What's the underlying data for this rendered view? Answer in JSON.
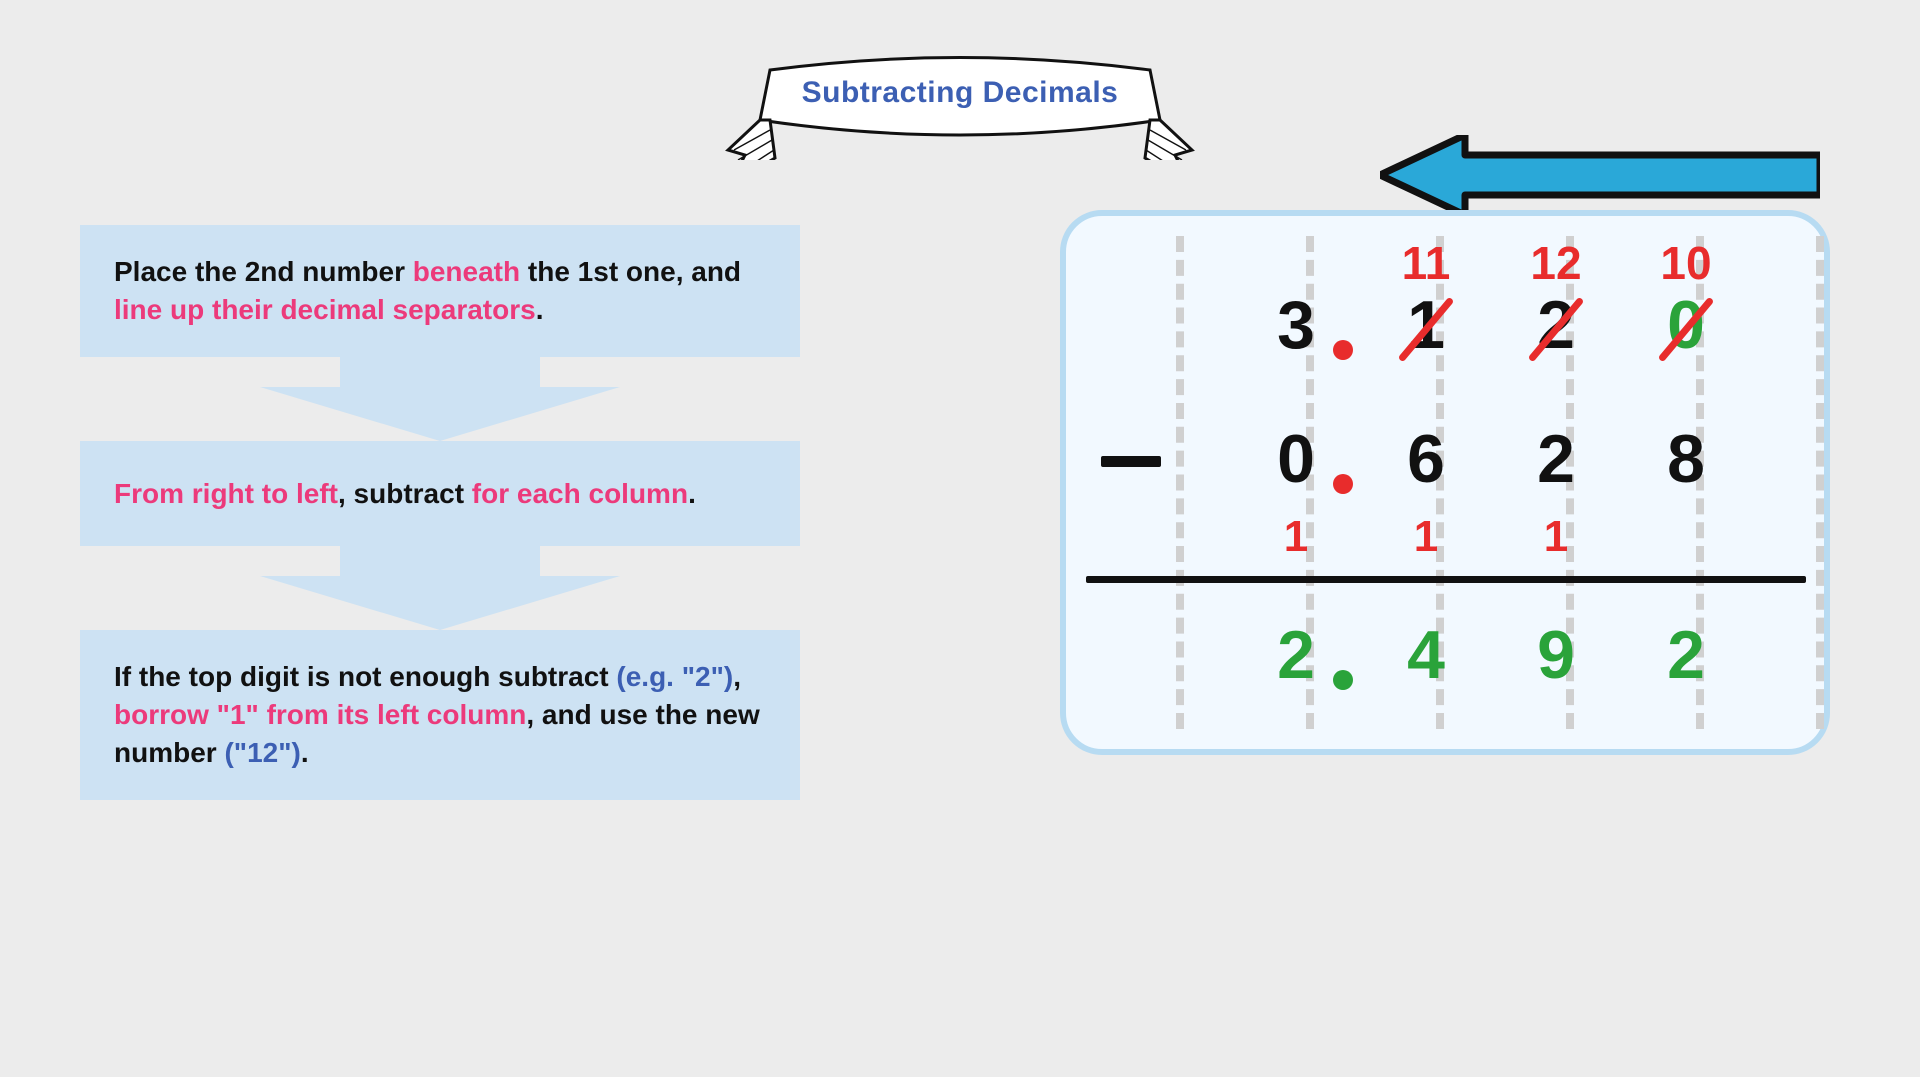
{
  "title": "Subtracting Decimals",
  "steps": {
    "s1_a": "Place the 2nd number ",
    "s1_b": "beneath",
    "s1_c": " the 1st one, and ",
    "s1_d": "line up their decimal separators",
    "s1_e": ".",
    "s2_a": "From right to left",
    "s2_b": ", subtract ",
    "s2_c": "for each column",
    "s2_d": ".",
    "s3_a": "If the top digit is not enough subtract ",
    "s3_b": "(e.g. \"2\")",
    "s3_c": ", ",
    "s3_d": "borrow \"1\" from its left column",
    "s3_e": ", and use the new number ",
    "s3_f": "(\"12\")",
    "s3_g": "."
  },
  "work": {
    "borrow": {
      "c3": "11",
      "c4": "12",
      "c5": "10"
    },
    "row1": {
      "c2": "3",
      "c3": "1",
      "c4": "2",
      "c5": "0"
    },
    "row2": {
      "c2": "0",
      "c3": "6",
      "c4": "2",
      "c5": "8"
    },
    "carry": {
      "c2": "1",
      "c3": "1",
      "c4": "1"
    },
    "result": {
      "c2": "2",
      "c3": "4",
      "c4": "9",
      "c5": "2"
    }
  }
}
